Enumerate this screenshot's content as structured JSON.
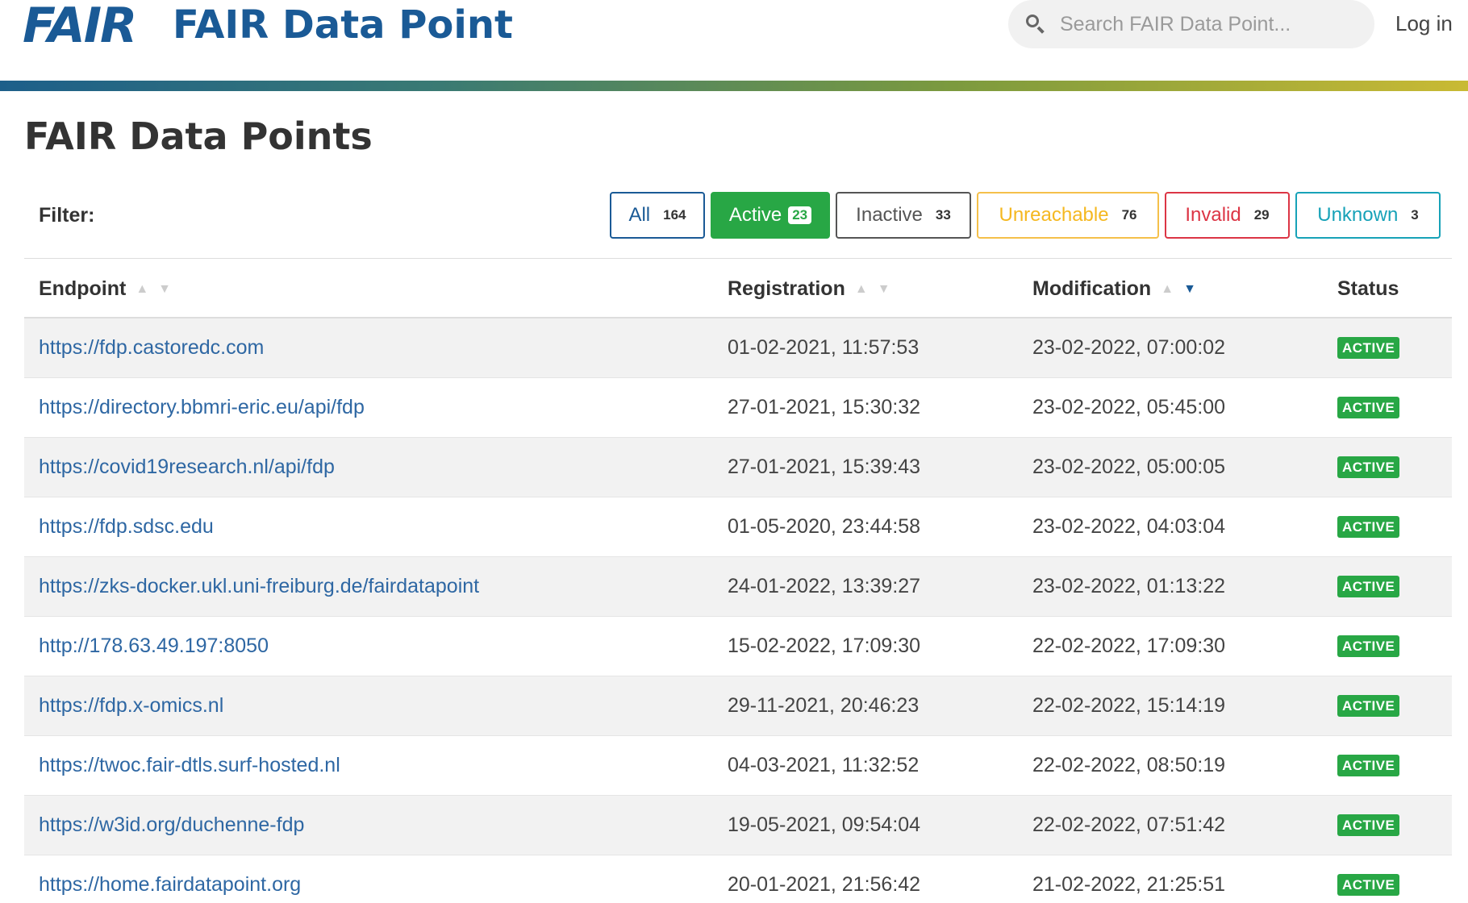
{
  "header": {
    "logo_text": "FAIR",
    "brand": "FAIR Data Point",
    "search_placeholder": "Search FAIR Data Point...",
    "login": "Log in"
  },
  "page_title": "FAIR Data Points",
  "filter": {
    "label": "Filter:",
    "buttons": [
      {
        "label": "All",
        "count": "164"
      },
      {
        "label": "Active",
        "count": "23"
      },
      {
        "label": "Inactive",
        "count": "33"
      },
      {
        "label": "Unreachable",
        "count": "76"
      },
      {
        "label": "Invalid",
        "count": "29"
      },
      {
        "label": "Unknown",
        "count": "3"
      }
    ]
  },
  "table": {
    "columns": [
      "Endpoint",
      "Registration",
      "Modification",
      "Status"
    ],
    "rows": [
      {
        "endpoint": "https://fdp.castoredc.com",
        "registration": "01-02-2021, 11:57:53",
        "modification": "23-02-2022, 07:00:02",
        "status": "ACTIVE"
      },
      {
        "endpoint": "https://directory.bbmri-eric.eu/api/fdp",
        "registration": "27-01-2021, 15:30:32",
        "modification": "23-02-2022, 05:45:00",
        "status": "ACTIVE"
      },
      {
        "endpoint": "https://covid19research.nl/api/fdp",
        "registration": "27-01-2021, 15:39:43",
        "modification": "23-02-2022, 05:00:05",
        "status": "ACTIVE"
      },
      {
        "endpoint": "https://fdp.sdsc.edu",
        "registration": "01-05-2020, 23:44:58",
        "modification": "23-02-2022, 04:03:04",
        "status": "ACTIVE"
      },
      {
        "endpoint": "https://zks-docker.ukl.uni-freiburg.de/fairdatapoint",
        "registration": "24-01-2022, 13:39:27",
        "modification": "23-02-2022, 01:13:22",
        "status": "ACTIVE"
      },
      {
        "endpoint": "http://178.63.49.197:8050",
        "registration": "15-02-2022, 17:09:30",
        "modification": "22-02-2022, 17:09:30",
        "status": "ACTIVE"
      },
      {
        "endpoint": "https://fdp.x-omics.nl",
        "registration": "29-11-2021, 20:46:23",
        "modification": "22-02-2022, 15:14:19",
        "status": "ACTIVE"
      },
      {
        "endpoint": "https://twoc.fair-dtls.surf-hosted.nl",
        "registration": "04-03-2021, 11:32:52",
        "modification": "22-02-2022, 08:50:19",
        "status": "ACTIVE"
      },
      {
        "endpoint": "https://w3id.org/duchenne-fdp",
        "registration": "19-05-2021, 09:54:04",
        "modification": "22-02-2022, 07:51:42",
        "status": "ACTIVE"
      },
      {
        "endpoint": "https://home.fairdatapoint.org",
        "registration": "20-01-2021, 21:56:42",
        "modification": "21-02-2022, 21:25:51",
        "status": "ACTIVE"
      }
    ]
  },
  "colors": {
    "brand": "#1a5a96",
    "active": "#28a745",
    "unreachable": "#f5b820",
    "invalid": "#dc3545",
    "unknown": "#17a2b8"
  }
}
